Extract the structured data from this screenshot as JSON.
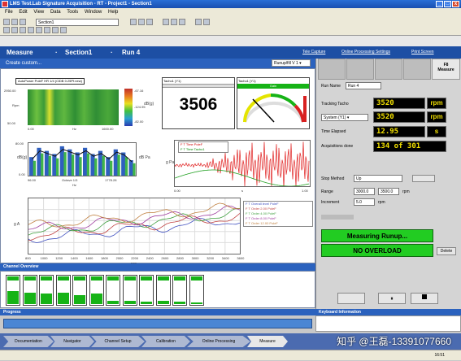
{
  "window": {
    "title": "LMS Test.Lab Signature Acquisition - RT - Project1 - Section1"
  },
  "menu": [
    "File",
    "Edit",
    "View",
    "Data",
    "Tools",
    "Window",
    "Help"
  ],
  "toolbar": {
    "section_select": "Section1"
  },
  "header": {
    "tabs": [
      "Measure",
      "Section1",
      "Run 4"
    ],
    "links": [
      "Tele Capture",
      "Online Processing Settings",
      "Print Screen"
    ]
  },
  "subbar": {
    "label": "Create custom...",
    "dropdown": "Runup/fill V 1"
  },
  "plots": {
    "spectrogram": {
      "title": "AutoPower PoleF HR 1/4 (ClDB 0.25Pf.new)",
      "xticks": [
        "0.00",
        "Hz",
        "1600.00"
      ],
      "yticks": [
        "2950.00",
        "Rpm",
        "50.00"
      ],
      "scale": [
        "-67.16",
        "-124.95",
        "-82.00"
      ],
      "ylabel": "dB(g)"
    },
    "digital": {
      "title": "Tacho1 (Y1)",
      "value": "3506"
    },
    "gauge": {
      "title": "Tacho1 (Y1)",
      "label": "Gain"
    },
    "bars": {
      "xticks": [
        "96.00",
        "Octave 1/3",
        "1778.28"
      ],
      "xunit": "Hz",
      "yticks": [
        "80.00",
        "0.00"
      ],
      "ylabel_left": "dB(g)",
      "ylabel_right": "dB Pa"
    },
    "timeblock": {
      "legend": [
        "F T Time PoleF",
        "F T Time Tacho1"
      ],
      "xticks": [
        "0.00",
        "s",
        "1.00"
      ],
      "ylabel": "g Pa"
    },
    "orders": {
      "legend": [
        "F T Overall level PoleF",
        "F T Order 2.00 PoleF",
        "F T Order 4.00 PoleF",
        "F T Order 8.00 PoleF",
        "F T Order 12.00 PoleF"
      ],
      "xticks": [
        "800",
        "1000",
        "1200",
        "1400",
        "1600",
        "1800",
        "2000",
        "2200",
        "2400",
        "2600",
        "2800",
        "3000",
        "3200",
        "3400",
        "3600"
      ],
      "xunit": "rpm",
      "ylabel": "g A"
    }
  },
  "right_panel": {
    "tab": "F8",
    "tab_sub": "Measure",
    "run_name_label": "Run Name",
    "run_name": "Run 4",
    "tracking_label": "Tracking Tacho",
    "tracking_value": "3520",
    "tracking_unit": "rpm",
    "tacho_select": "System (Y1)",
    "tacho2_value": "3520",
    "tacho2_unit": "rpm",
    "time_label": "Time Elapsed",
    "time_value": "12.95",
    "time_unit": "s",
    "acq_label": "Acquisitions done",
    "acq_value": "134 of 301",
    "stop_label": "Stop Method",
    "stop_value": "Up",
    "range_label": "Range",
    "range_from": "3000.0",
    "range_to": "3500.0",
    "range_unit": "rpm",
    "incr_label": "Increment",
    "incr_value": "5.0",
    "incr_unit": "rpm",
    "status1": "Measuring Runup...",
    "status2": "NO OVERLOAD",
    "delete_btn": "Delete"
  },
  "channels": {
    "title": "Channel Overview",
    "levels": [
      0.45,
      0.4,
      0.35,
      0.4,
      0.3,
      0.35,
      0.12,
      0.1,
      0.08,
      0.1,
      0.08,
      0.06
    ]
  },
  "progress": {
    "title": "Progress"
  },
  "keyboard": {
    "title": "Keyboard Information"
  },
  "workflow": [
    "Documentation",
    "Navigator",
    "Channel Setup",
    "Calibration",
    "Online Processing",
    "Measure"
  ],
  "statusbar": {
    "time": "16:51"
  },
  "watermark": "知乎 @王磊-13391077660"
}
